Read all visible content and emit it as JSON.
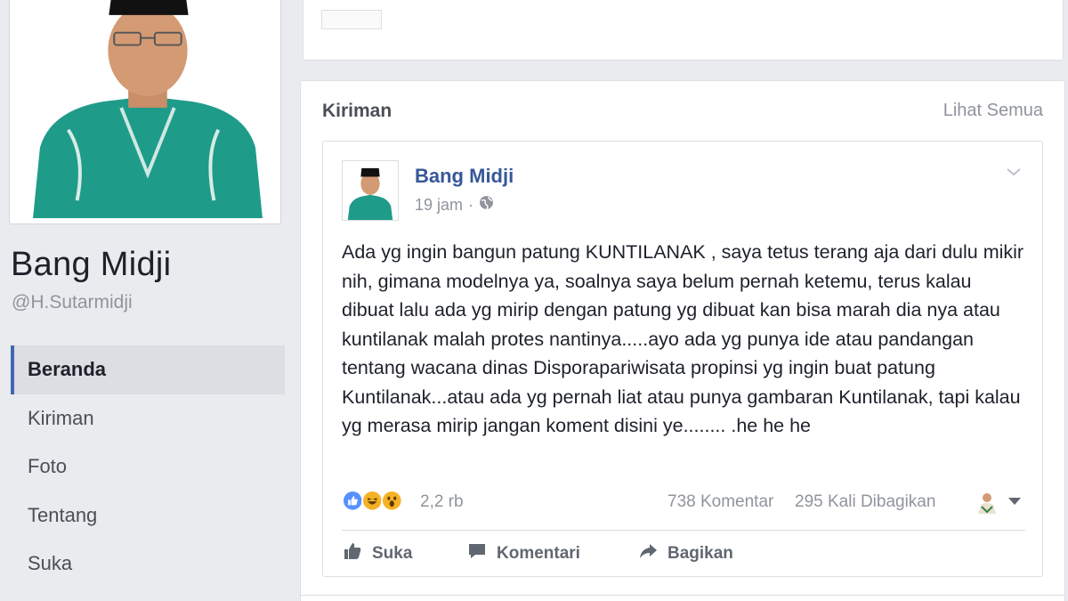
{
  "profile": {
    "name": "Bang Midji",
    "handle": "@H.Sutarmidji"
  },
  "left_nav": {
    "items": [
      {
        "label": "Beranda",
        "active": true
      },
      {
        "label": "Kiriman",
        "active": false
      },
      {
        "label": "Foto",
        "active": false
      },
      {
        "label": "Tentang",
        "active": false
      },
      {
        "label": "Suka",
        "active": false
      }
    ]
  },
  "posts_section": {
    "title": "Kiriman",
    "see_all": "Lihat Semua"
  },
  "post": {
    "author": "Bang Midji",
    "time": "19 jam",
    "separator": "·",
    "privacy_icon": "globe-icon",
    "body": "Ada yg ingin bangun patung KUNTILANAK , saya tetus terang aja dari dulu mikir nih, gimana modelnya ya, soalnya saya belum pernah ketemu, terus kalau dibuat lalu ada yg mirip dengan patung yg dibuat kan bisa marah dia nya atau kuntilanak malah protes nantinya.....ayo ada yg punya ide atau pandangan tentang wacana dinas Disporapariwisata propinsi yg ingin buat patung Kuntilanak...atau ada yg pernah liat atau punya gambaran Kuntilanak, tapi kalau yg merasa mirip jangan koment disini ye........ .he he he",
    "reactions": {
      "icons": [
        "like-reaction-icon",
        "haha-reaction-icon",
        "wow-reaction-icon"
      ],
      "count": "2,2 rb"
    },
    "comments": "738 Komentar",
    "shares": "295 Kali Dibagikan",
    "actions": {
      "like": "Suka",
      "comment": "Komentari",
      "share": "Bagikan"
    }
  },
  "colors": {
    "link_blue": "#365899",
    "accent": "#4267b2",
    "background": "#e9ebee",
    "muted": "#90949c"
  }
}
